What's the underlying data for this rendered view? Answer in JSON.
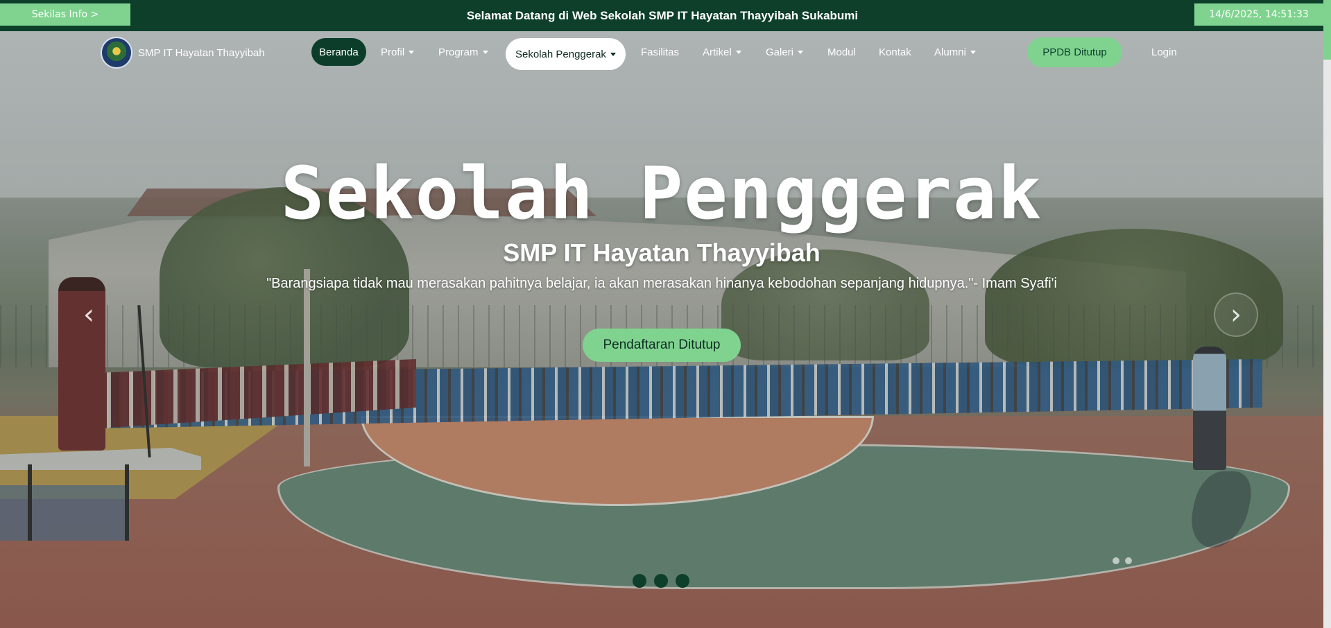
{
  "topbar": {
    "sekilas_label": "Sekilas Info >",
    "welcome_text": "Selamat Datang di Web Sekolah SMP IT Hayatan Thayyibah Sukabumi",
    "clock_text": "14/6/2025, 14:51:33"
  },
  "nav": {
    "brand_name": "SMP IT Hayatan Thayyibah",
    "items": [
      {
        "label": "Beranda",
        "dropdown": false,
        "active": true
      },
      {
        "label": "Profil",
        "dropdown": true
      },
      {
        "label": "Program",
        "dropdown": true
      },
      {
        "label": "Sekolah Penggerak",
        "dropdown": true,
        "highlighted": true
      },
      {
        "label": "Fasilitas",
        "dropdown": false
      },
      {
        "label": "Artikel",
        "dropdown": true
      },
      {
        "label": "Galeri",
        "dropdown": true
      },
      {
        "label": "Modul",
        "dropdown": false
      },
      {
        "label": "Kontak",
        "dropdown": false
      },
      {
        "label": "Alumni",
        "dropdown": true
      }
    ],
    "ppdb_label": "PPDB Ditutup",
    "login_label": "Login"
  },
  "hero": {
    "title": "Sekolah Penggerak",
    "subtitle": "SMP IT Hayatan Thayyibah",
    "quote": "\"Barangsiapa tidak mau merasakan pahitnya belajar, ia akan merasakan hinanya kebodohan sepanjang hidupnya.\"- Imam Syafi'i",
    "cta_label": "Pendaftaran Ditutup",
    "prev_icon": "‹",
    "next_icon": "›"
  },
  "colors": {
    "dark_green": "#0d3f2b",
    "light_green": "#7fd38f"
  },
  "carousel": {
    "slide_count": 3
  }
}
